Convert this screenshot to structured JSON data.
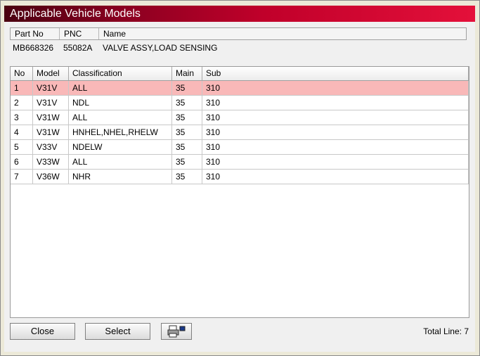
{
  "window": {
    "title": "Applicable Vehicle Models"
  },
  "part_info": {
    "headers": {
      "part_no": "Part No",
      "pnc": "PNC",
      "name": "Name"
    },
    "values": {
      "part_no": "MB668326",
      "pnc": "55082A",
      "name": "VALVE ASSY,LOAD SENSING"
    }
  },
  "models_table": {
    "headers": {
      "no": "No",
      "model": "Model",
      "classification": "Classification",
      "main": "Main",
      "sub": "Sub"
    },
    "rows": [
      {
        "no": "1",
        "model": "V31V",
        "classification": "ALL",
        "main": "35",
        "sub": "310"
      },
      {
        "no": "2",
        "model": "V31V",
        "classification": "NDL",
        "main": "35",
        "sub": "310"
      },
      {
        "no": "3",
        "model": "V31W",
        "classification": "ALL",
        "main": "35",
        "sub": "310"
      },
      {
        "no": "4",
        "model": "V31W",
        "classification": "HNHEL,NHEL,RHELW",
        "main": "35",
        "sub": "310"
      },
      {
        "no": "5",
        "model": "V33V",
        "classification": "NDELW",
        "main": "35",
        "sub": "310"
      },
      {
        "no": "6",
        "model": "V33W",
        "classification": "ALL",
        "main": "35",
        "sub": "310"
      },
      {
        "no": "7",
        "model": "V36W",
        "classification": "NHR",
        "main": "35",
        "sub": "310"
      }
    ],
    "selected_row": "1",
    "selected_color": "#f9b8b8"
  },
  "footer": {
    "close_label": "Close",
    "select_label": "Select",
    "print_icon": "printer-icon",
    "total_text": "Total Line: 7"
  },
  "colors": {
    "title_bar_start": "#4a0010",
    "title_bar_end": "#e4103a"
  }
}
